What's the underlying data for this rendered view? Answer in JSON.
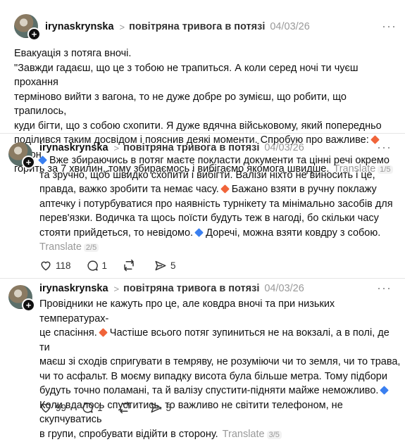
{
  "posts": [
    {
      "username": "irynaskrynska",
      "topic": "повітряна тривога в потязі",
      "date": "04/03/26",
      "lines": [
        "Евакуація з потяга вночі.",
        "\"Завжди гадаєш, що це з тобою не трапиться. А коли серед ночі ти чуєш прохання",
        "терміново вийти з вагона, то не дуже добре ро зумієш, що робити, що трапилось,",
        "куди бігти, що з собою схопити. Я дуже вдячна військовому, який попередньо",
        "поділився таким досвідом і пояснив деякі моменти. Спробую про важливе:",
        "Вагон",
        "горить за 7 хвилин, тому збираємось і вибігаємо якомога швидше."
      ],
      "translate": "Translate",
      "page": "1/5"
    },
    {
      "username": "irynaskrynska",
      "topic": "повітряна тривога в потязі",
      "date": "04/03/26",
      "lines": [
        "Вже збираючись в потяг маєте покласти документи та цінні речі окремо",
        "та зручно, щоб швидко схопити і вибігти. Валізи ніхто не виносить і це,",
        "правда, важко зробити та немає часу.",
        "Бажано взяти в ручну поклажу",
        "аптечку і потурбуватися про наявність турнікету та мінімально засобів для",
        "перев'язки. Водичка та щось поїсти будуть теж в нагоді, бо скільки часу",
        "стояти прийдеться, то невідомо.",
        "Доречі, можна взяти ковдру з собою."
      ],
      "translate": "Translate",
      "page": "2/5",
      "likes": "118",
      "comments": "1",
      "shares": "5"
    },
    {
      "username": "irynaskrynska",
      "topic": "повітряна тривога в потязі",
      "date": "04/03/26",
      "lines": [
        "Провідники не кажуть про це, але ковдра вночі та при низьких температурах-",
        "це спасіння.",
        "Частіше всього потяг зупиниться не на вокзалі, а в полі, де ти",
        "маєш зі сходів спригувати в темряву, не розуміючи чи то земля, чи то трава,",
        "чи то асфальт. В моєму випадку висота була більше метра. Тому підбори",
        "будуть точно поламані, та й валізу спустити-підняти майже неможливо.",
        "Коли вдалось спуститись, то важливо не світити телефоном, не скупчуватись",
        "в групи, спробувати відійти в сторону."
      ],
      "translate": "Translate",
      "page": "3/5",
      "likes": "99",
      "comments": "1",
      "shares": "5"
    }
  ],
  "icons": {
    "more": "more-icon",
    "like": "heart-icon",
    "comment": "comment-icon",
    "repost": "repost-icon",
    "share": "share-icon"
  },
  "colors": {
    "orange_diamond": "#f0643a",
    "blue_diamond": "#3a7ff0",
    "muted": "#999999"
  }
}
